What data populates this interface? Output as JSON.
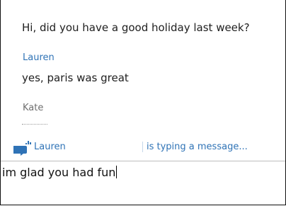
{
  "conversation": {
    "messages": [
      {
        "text": "Hi, did you have a good holiday last week?"
      },
      {
        "sender": "Lauren",
        "text": "yes, paris was great"
      },
      {
        "sender": "Kate"
      }
    ]
  },
  "typing_indicator": {
    "icon": "typing-bubble-icon",
    "name": "Lauren",
    "message": "is typing a message..."
  },
  "compose": {
    "value": "im glad you had fun"
  },
  "colors": {
    "accent": "#2f73b6",
    "secondary_text": "#6f6f6f"
  }
}
